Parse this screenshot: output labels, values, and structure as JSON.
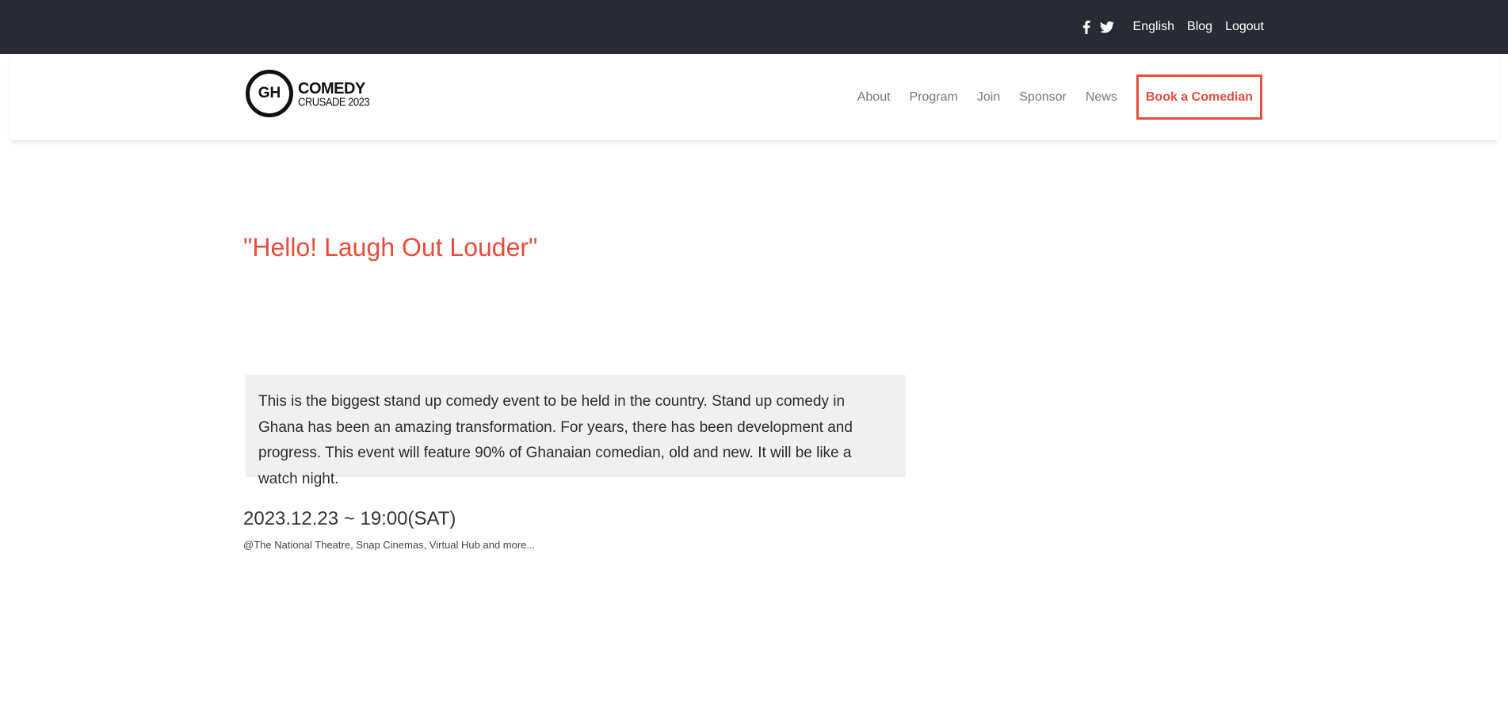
{
  "topbar": {
    "social": [
      {
        "icon": "facebook-icon"
      },
      {
        "icon": "twitter-icon"
      }
    ],
    "links": [
      "English",
      "Blog",
      "Logout"
    ]
  },
  "brand": {
    "initials": "GH",
    "line1": "COMEDY",
    "line2": "CRUSADE 2023"
  },
  "nav": {
    "items": [
      "About",
      "Program",
      "Join",
      "Sponsor",
      "News"
    ],
    "cta": "Book a Comedian"
  },
  "hero": {
    "title": "\"Hello! Laugh Out Louder\""
  },
  "event": {
    "description": "This is the biggest stand up comedy event to be held in the country. Stand up comedy in Ghana has been an amazing transformation. For years, there has been development and progress. This event will feature 90% of Ghanaian comedian, old and new. It will be like a watch night.",
    "datetime": "2023.12.23 ~ 19:00(SAT)",
    "venue": "@The National Theatre, Snap Cinemas, Virtual Hub and more..."
  },
  "colors": {
    "topbar_bg": "#282b33",
    "accent": "#e74c3c",
    "description_bg": "#f0f0f0"
  }
}
